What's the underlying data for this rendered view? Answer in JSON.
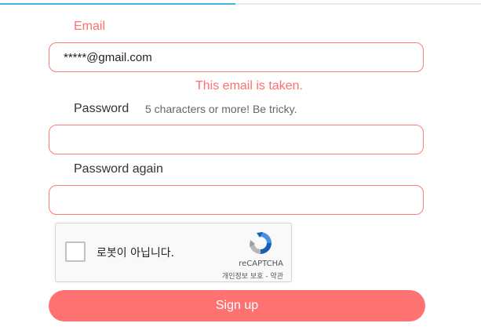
{
  "progress": {
    "fraction": 0.49,
    "fill_color": "#41b6e6",
    "track_color": "#e8e8e8"
  },
  "email": {
    "label": "Email",
    "value": "*****@gmail.com",
    "error": "This email is taken."
  },
  "password": {
    "label": "Password",
    "hint": "5 characters or more! Be tricky.",
    "value": ""
  },
  "password_again": {
    "label": "Password again",
    "value": ""
  },
  "recaptcha": {
    "checkbox_label": "로봇이 아닙니다.",
    "brand": "reCAPTCHA",
    "privacy": "개인정보 보호 - 약관",
    "icon": "recaptcha-logo-icon"
  },
  "submit": {
    "label": "Sign up",
    "color": "#ff7272"
  },
  "colors": {
    "error": "#ff6f6f",
    "field_border": "#ff7a7a"
  }
}
